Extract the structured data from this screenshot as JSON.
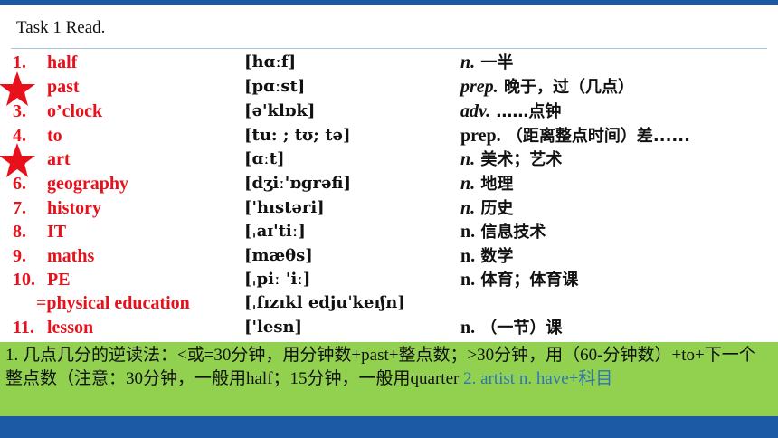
{
  "title": "Task 1 Read.",
  "rows": [
    {
      "num": "1.",
      "word": "half",
      "ipa": "[hɑːf]",
      "pos": "n.",
      "pos_italic": true,
      "meaning": "一半"
    },
    {
      "num": "2.",
      "word": "past",
      "ipa": "[pɑːst]",
      "pos": "prep.",
      "pos_italic": true,
      "meaning": "晚于，过（几点）"
    },
    {
      "num": "3.",
      "word": "o’clock",
      "ipa": "[ə'klɒk]",
      "pos": "adv.",
      "pos_italic": true,
      "meaning": "……点钟"
    },
    {
      "num": "4.",
      "word": "to",
      "ipa": "[tu: ; tʊ; tə]",
      "pos": "prep.",
      "pos_italic": false,
      "meaning": "（距离整点时间）差......"
    },
    {
      "num": "5.",
      "word": "art",
      "ipa": "[ɑːt]",
      "pos": "n.",
      "pos_italic": true,
      "meaning": "美术；艺术"
    },
    {
      "num": "6.",
      "word": "geography",
      "ipa": "[dʒiː'ɒgrəfi]",
      "pos": "n.",
      "pos_italic": true,
      "meaning": "地理"
    },
    {
      "num": "7.",
      "word": "history",
      "ipa": "['hɪstəri]",
      "pos": "n.",
      "pos_italic": true,
      "meaning": "历史"
    },
    {
      "num": "8.",
      "word": "IT",
      "ipa": "[ˌaɪ'tiː]",
      "pos": "n.",
      "pos_italic": false,
      "meaning": "信息技术"
    },
    {
      "num": "9.",
      "word": "maths",
      "ipa": "[mæθs]",
      "pos": "n.",
      "pos_italic": false,
      "meaning": "数学"
    },
    {
      "num": "10.",
      "word": "PE",
      "ipa": "[ˌpiː 'iː]",
      "pos": "n.",
      "pos_italic": false,
      "meaning": "体育；体育课"
    },
    {
      "num": "",
      "word": "=physical education",
      "ipa": "[ˌfɪzɪkl edjuˈkeɪʃn]",
      "pos": "",
      "pos_italic": false,
      "meaning": ""
    },
    {
      "num": "11.",
      "word": "lesson",
      "ipa": "['lesn]",
      "pos": "n.",
      "pos_italic": false,
      "meaning": "（一节）课"
    }
  ],
  "note": {
    "text": "1. 几点几分的逆读法：<或=30分钟，用分钟数+past+整点数；>30分钟，用（60-分钟数）+to+下一个整点数（注意：30分钟，一般用half；15分钟，一般用quarter",
    "extra": "2. artist   n.  have+科目"
  },
  "colors": {
    "red": "#e8101a",
    "blue_bar": "#1c5aa6",
    "green_box": "#92d050",
    "note_blue": "#2e75b6"
  },
  "icons": {
    "star": "star-icon"
  }
}
